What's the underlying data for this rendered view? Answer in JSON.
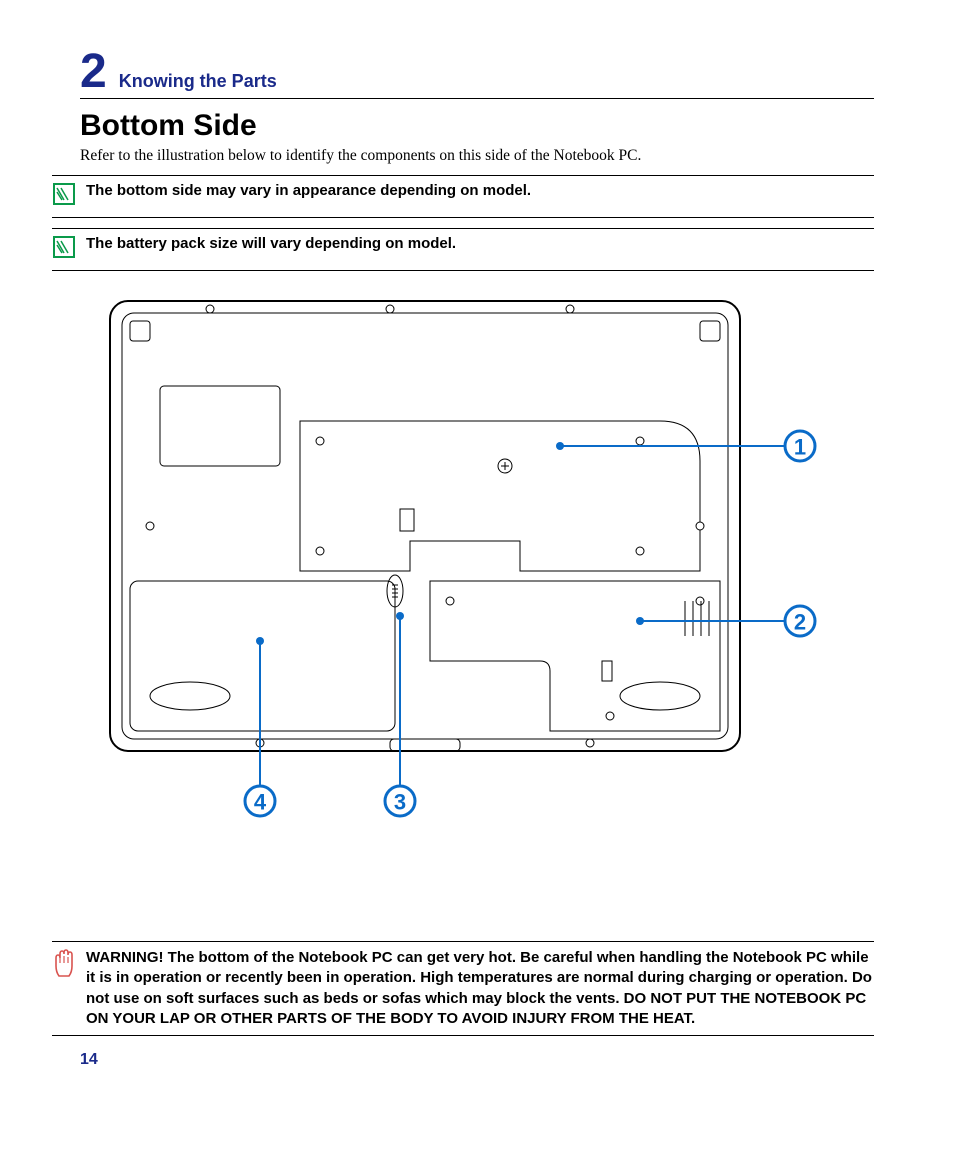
{
  "header": {
    "chapter_number": "2",
    "chapter_title": "Knowing the Parts"
  },
  "section": {
    "title": "Bottom Side",
    "intro": "Refer to the illustration below to identify the components on this side of the Notebook PC."
  },
  "notes": [
    {
      "text": "The bottom side may vary in appearance depending on model."
    },
    {
      "text": "The battery pack size will vary depending on model."
    }
  ],
  "callouts": {
    "c1": "1",
    "c2": "2",
    "c3": "3",
    "c4": "4"
  },
  "warning": {
    "text": "WARNING!  The bottom of the Notebook PC can get very hot. Be careful when handling the Notebook PC while it is in operation or recently been in operation. High temperatures are normal during charging or operation. Do not use on soft surfaces such as beds or sofas which may block the vents. DO NOT PUT THE NOTEBOOK PC ON YOUR LAP OR OTHER PARTS OF THE BODY TO AVOID INJURY FROM THE HEAT."
  },
  "page_number": "14"
}
